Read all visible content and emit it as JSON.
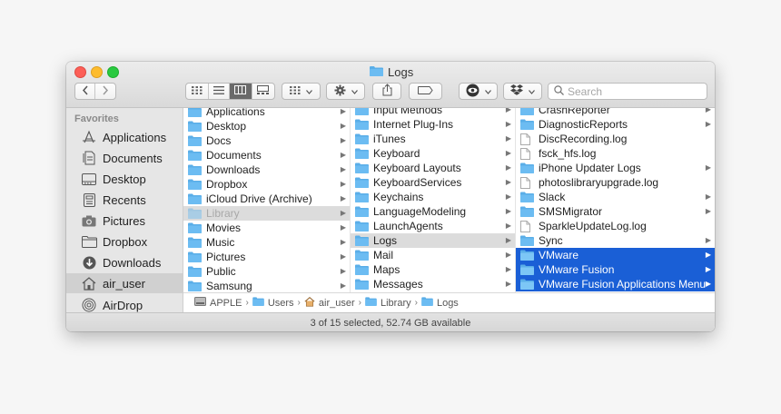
{
  "window": {
    "title": "Logs"
  },
  "toolbar": {
    "search_placeholder": "Search",
    "back_icon": "chevron-left-icon",
    "forward_icon": "chevron-right-icon"
  },
  "sidebar": {
    "header": "Favorites",
    "items": [
      {
        "label": "Applications",
        "icon": "applications-icon"
      },
      {
        "label": "Documents",
        "icon": "documents-icon"
      },
      {
        "label": "Desktop",
        "icon": "desktop-icon"
      },
      {
        "label": "Recents",
        "icon": "recents-icon"
      },
      {
        "label": "Pictures",
        "icon": "pictures-icon"
      },
      {
        "label": "Dropbox",
        "icon": "dropbox-folder-icon"
      },
      {
        "label": "Downloads",
        "icon": "downloads-icon"
      },
      {
        "label": "air_user",
        "icon": "home-icon"
      },
      {
        "label": "AirDrop",
        "icon": "airdrop-icon"
      }
    ]
  },
  "columns": {
    "col1": [
      {
        "label": "Applications"
      },
      {
        "label": "Desktop"
      },
      {
        "label": "Docs"
      },
      {
        "label": "Documents"
      },
      {
        "label": "Downloads"
      },
      {
        "label": "Dropbox"
      },
      {
        "label": "iCloud Drive (Archive)"
      },
      {
        "label": "Library"
      },
      {
        "label": "Movies"
      },
      {
        "label": "Music"
      },
      {
        "label": "Pictures"
      },
      {
        "label": "Public"
      },
      {
        "label": "Samsung"
      }
    ],
    "col2": [
      {
        "label": "Input Methods"
      },
      {
        "label": "Internet Plug-Ins"
      },
      {
        "label": "iTunes"
      },
      {
        "label": "Keyboard"
      },
      {
        "label": "Keyboard Layouts"
      },
      {
        "label": "KeyboardServices"
      },
      {
        "label": "Keychains"
      },
      {
        "label": "LanguageModeling"
      },
      {
        "label": "LaunchAgents"
      },
      {
        "label": "Logs"
      },
      {
        "label": "Mail"
      },
      {
        "label": "Maps"
      },
      {
        "label": "Messages"
      }
    ],
    "col3": [
      {
        "label": "CrashReporter"
      },
      {
        "label": "DiagnosticReports"
      },
      {
        "label": "DiscRecording.log"
      },
      {
        "label": "fsck_hfs.log"
      },
      {
        "label": "iPhone Updater Logs"
      },
      {
        "label": "photoslibraryupgrade.log"
      },
      {
        "label": "Slack"
      },
      {
        "label": "SMSMigrator"
      },
      {
        "label": "SparkleUpdateLog.log"
      },
      {
        "label": "Sync"
      },
      {
        "label": "VMware"
      },
      {
        "label": "VMware Fusion"
      },
      {
        "label": "VMware Fusion Applications Menu"
      }
    ]
  },
  "path_bar": [
    "APPLE",
    "Users",
    "air_user",
    "Library",
    "Logs"
  ],
  "status": "3 of 15 selected, 52.74 GB available"
}
